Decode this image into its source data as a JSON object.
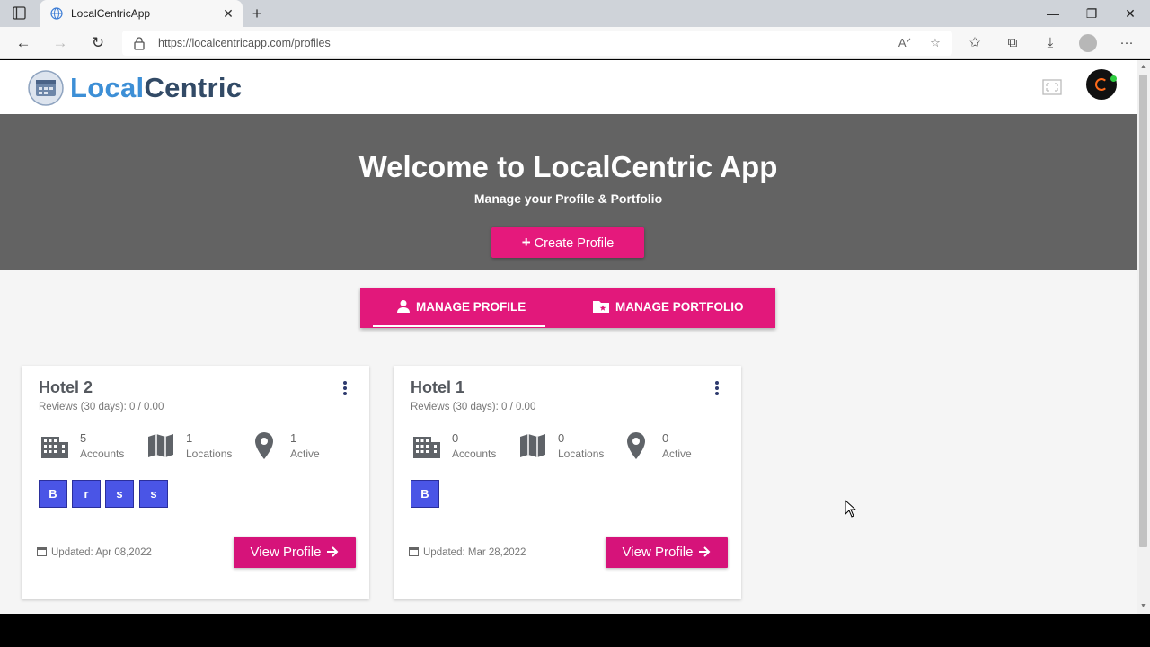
{
  "browser": {
    "tab_title": "LocalCentricApp",
    "url": "https://localcentricapp.com/profiles"
  },
  "app": {
    "logo_part1": "Local",
    "logo_part2": "Centric",
    "brand_color": "#e5197c",
    "logo_blue": "#3d8fd6"
  },
  "hero": {
    "title": "Welcome to LocalCentric App",
    "subtitle": "Manage your Profile & Portfolio",
    "create_button": "Create Profile"
  },
  "tabs": [
    {
      "label": "MANAGE PROFILE",
      "icon": "person-icon",
      "active": true
    },
    {
      "label": "MANAGE PORTFOLIO",
      "icon": "folder-star-icon",
      "active": false
    }
  ],
  "cards": [
    {
      "title": "Hotel 2",
      "reviews": "Reviews (30 days): 0 / 0.00",
      "stats": [
        {
          "value": "5",
          "label": "Accounts",
          "icon": "building-icon"
        },
        {
          "value": "1",
          "label": "Locations",
          "icon": "map-icon"
        },
        {
          "value": "1",
          "label": "Active",
          "icon": "location-pin-icon"
        }
      ],
      "chips": [
        "B",
        "r",
        "s",
        "s"
      ],
      "updated": "Updated: Apr 08,2022",
      "button": "View Profile"
    },
    {
      "title": "Hotel 1",
      "reviews": "Reviews (30 days): 0 / 0.00",
      "stats": [
        {
          "value": "0",
          "label": "Accounts",
          "icon": "building-icon"
        },
        {
          "value": "0",
          "label": "Locations",
          "icon": "map-icon"
        },
        {
          "value": "0",
          "label": "Active",
          "icon": "location-pin-icon"
        }
      ],
      "chips": [
        "B"
      ],
      "updated": "Updated: Mar 28,2022",
      "button": "View Profile"
    }
  ]
}
